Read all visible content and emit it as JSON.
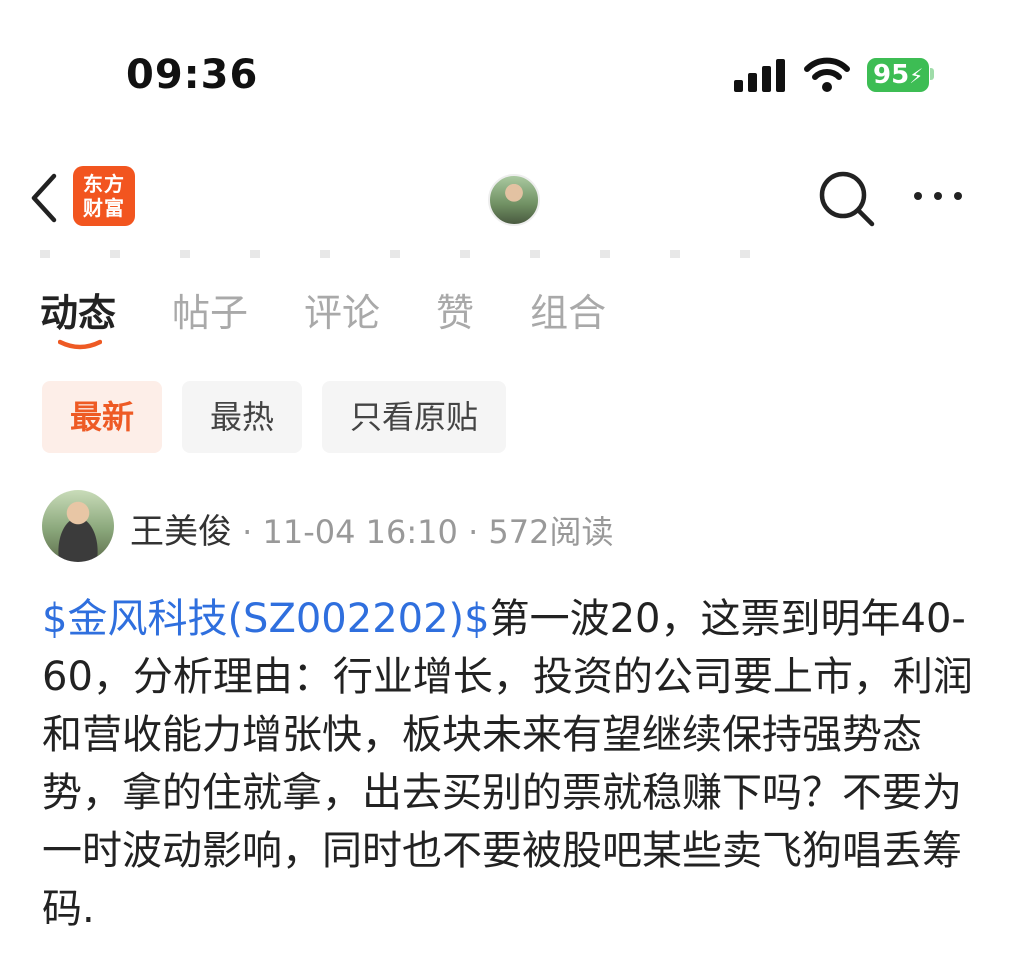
{
  "status_bar": {
    "time": "09:36",
    "battery": "95",
    "icons": [
      "signal-icon",
      "wifi-icon",
      "battery-icon"
    ]
  },
  "nav": {
    "app_logo_line1": "东方",
    "app_logo_line2": "财富",
    "icons": [
      "back-icon",
      "search-icon",
      "more-icon"
    ]
  },
  "tabs": [
    {
      "label": "动态",
      "active": true
    },
    {
      "label": "帖子",
      "active": false
    },
    {
      "label": "评论",
      "active": false
    },
    {
      "label": "赞",
      "active": false
    },
    {
      "label": "组合",
      "active": false
    }
  ],
  "filters": [
    {
      "label": "最新",
      "active": true
    },
    {
      "label": "最热",
      "active": false
    },
    {
      "label": "只看原贴",
      "active": false
    }
  ],
  "post": {
    "author": "王美俊",
    "date": "11-04 16:10",
    "reads": "572阅读",
    "stock_link": "$金风科技(SZ002202)$",
    "text": "第一波20，这票到明年40-60，分析理由：行业增长，投资的公司要上市，利润和营收能力增张快，板块未来有望继续保持强势态势，拿的住就拿，出去买别的票就稳赚下吗？不要为一时波动影响，同时也不要被股吧某些卖飞狗唱丢筹码."
  },
  "colors": {
    "accent": "#ee5a24",
    "logo": "#f2551f",
    "link": "#2f6fde",
    "battery": "#3dbd54"
  }
}
